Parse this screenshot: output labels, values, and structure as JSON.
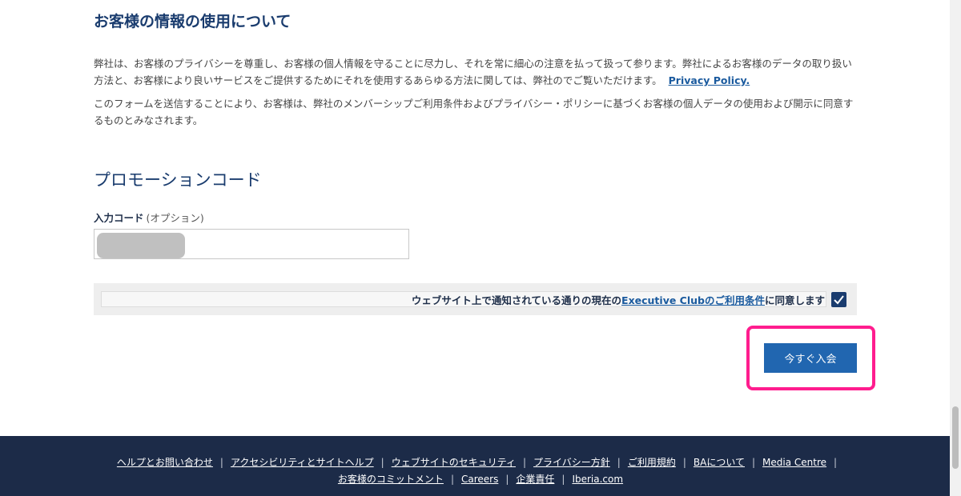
{
  "privacy": {
    "title": "お客様の情報の使用について",
    "paragraph1": "弊社は、お客様のプライバシーを尊重し、お客様の個人情報を守ることに尽力し、それを常に細心の注意を払って扱って参ります。弊社によるお客様のデータの取り扱い方法と、お客様により良いサービスをご提供するためにそれを使用するあらゆる方法に関しては、弊社のでご覧いただけます。",
    "policy_link": "Privacy Policy.",
    "paragraph2": "このフォームを送信することにより、お客様は、弊社のメンバーシップご利用条件およびプライバシー・ポリシーに基づくお客様の個人データの使用および開示に同意するものとみなされます。"
  },
  "promo": {
    "title": "プロモーションコード",
    "label": "入力コード",
    "optional": "(オプション)",
    "value": ""
  },
  "consent": {
    "text_before": "ウェブサイト上で通知されている通りの現在の",
    "link": "Executive Clubのご利用条件",
    "text_after": "に同意します",
    "checked": true
  },
  "submit": {
    "label": "今すぐ入会"
  },
  "colors": {
    "footer_bg": "#1c2b48",
    "primary_button": "#2166b0",
    "heading": "#1a3c6e",
    "highlight": "#ff1d8e"
  },
  "footer": {
    "row1": [
      "ヘルプとお問い合わせ",
      "アクセシビリティとサイトヘルプ",
      "ウェブサイトのセキュリティ",
      "プライバシー方針",
      "ご利用規約",
      "BAについて",
      "Media Centre"
    ],
    "row2": [
      "お客様のコミットメント",
      "Careers",
      "企業責任",
      "Iberia.com"
    ]
  }
}
